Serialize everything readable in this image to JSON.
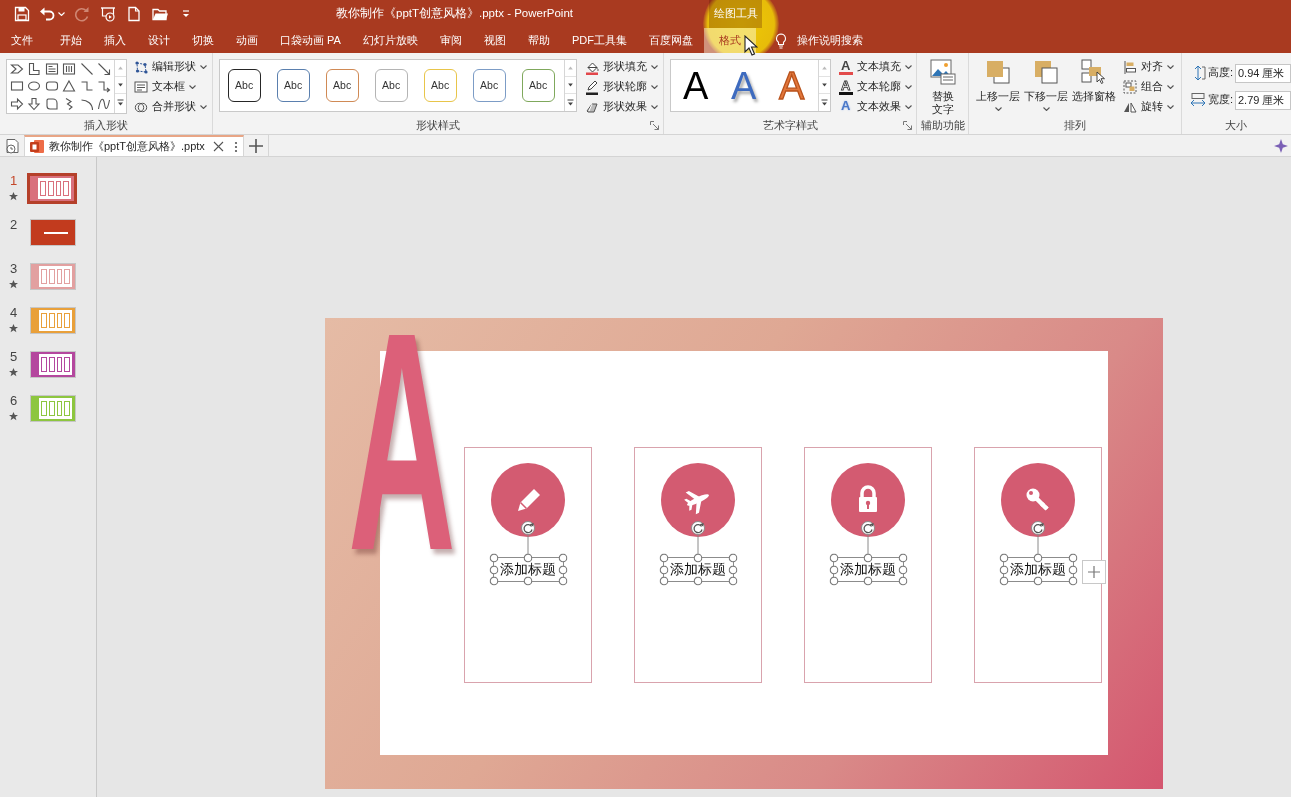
{
  "window": {
    "title": "教你制作《pptT创意风格》.pptx - PowerPoint",
    "context_label": "绘图工具"
  },
  "quick_access": [
    {
      "disabled": false
    },
    {
      "disabled": false
    },
    {
      "disabled": true
    },
    {
      "disabled": false
    },
    {
      "disabled": false
    },
    {
      "disabled": false
    },
    {
      "disabled": false
    }
  ],
  "menu": {
    "tabs": [
      {
        "label": "文件",
        "selected": false
      },
      {
        "label": "开始",
        "selected": false
      },
      {
        "label": "插入",
        "selected": false
      },
      {
        "label": "设计",
        "selected": false
      },
      {
        "label": "切换",
        "selected": false
      },
      {
        "label": "动画",
        "selected": false
      },
      {
        "label": "口袋动画 PA",
        "selected": false
      },
      {
        "label": "幻灯片放映",
        "selected": false
      },
      {
        "label": "审阅",
        "selected": false
      },
      {
        "label": "视图",
        "selected": false
      },
      {
        "label": "帮助",
        "selected": false
      },
      {
        "label": "PDF工具集",
        "selected": false
      },
      {
        "label": "百度网盘",
        "selected": false
      },
      {
        "label": "格式",
        "selected": true
      }
    ],
    "search": "操作说明搜索"
  },
  "insert_shapes": {
    "label": "插入形状",
    "commands": [
      {
        "label": "编辑形状",
        "dropdown": true
      },
      {
        "label": "文本框",
        "dropdown": true
      },
      {
        "label": "合并形状",
        "dropdown": true
      }
    ]
  },
  "shape_styles": {
    "label": "形状样式",
    "styles": [
      {
        "text": "Abc",
        "color": "#262626"
      },
      {
        "text": "Abc",
        "color": "#5a7fae"
      },
      {
        "text": "Abc",
        "color": "#d08a55"
      },
      {
        "text": "Abc",
        "color": "#b4b4b4"
      },
      {
        "text": "Abc",
        "color": "#e8c54a"
      },
      {
        "text": "Abc",
        "color": "#7c9cc6"
      },
      {
        "text": "Abc",
        "color": "#7fa85c"
      }
    ],
    "commands": [
      {
        "label": "形状填充",
        "dropdown": true
      },
      {
        "label": "形状轮廓",
        "dropdown": true
      },
      {
        "label": "形状效果",
        "dropdown": true
      }
    ]
  },
  "wordart_styles": {
    "label": "艺术字样式",
    "styles": [
      {
        "text": "A",
        "kind": "solid",
        "color": "#000000"
      },
      {
        "text": "A",
        "kind": "shadow",
        "color": "#3e6bbf"
      },
      {
        "text": "A",
        "kind": "outline",
        "color": "#e2763a"
      }
    ],
    "commands": [
      {
        "glyph": "A",
        "label": "文本填充",
        "dropdown": true
      },
      {
        "glyph": "A",
        "label": "文本轮廓",
        "dropdown": true
      },
      {
        "glyph": "A",
        "label": "文本效果",
        "dropdown": true
      }
    ]
  },
  "accessibility": {
    "label": "辅助功能",
    "commands": [
      {
        "label": "替换文字",
        "dropdown": false
      }
    ]
  },
  "arrange": {
    "label": "排列",
    "commands": [
      {
        "label": "上移一层",
        "dropdown": true
      },
      {
        "label": "下移一层",
        "dropdown": true
      },
      {
        "label": "选择窗格",
        "dropdown": false
      },
      {
        "label": "对齐",
        "dropdown": true
      },
      {
        "label": "组合",
        "dropdown": true
      },
      {
        "label": "旋转",
        "dropdown": true
      }
    ]
  },
  "size": {
    "label": "大小",
    "fields": [
      {
        "label": "高度:",
        "value": "0.94 厘米"
      },
      {
        "label": "宽度:",
        "value": "2.79 厘米"
      }
    ]
  },
  "document_tabs": [
    {
      "title": "教你制作《pptT创意风格》.pptx",
      "selected": true
    }
  ],
  "slides": [
    {
      "number": "1",
      "selected": true,
      "animated": true,
      "color": "#d9707c",
      "kind": "cards"
    },
    {
      "number": "2",
      "selected": false,
      "animated": false,
      "color": "#c23b1e",
      "kind": "cover"
    },
    {
      "number": "3",
      "selected": false,
      "animated": true,
      "color": "#e2a0a0",
      "kind": "cards"
    },
    {
      "number": "4",
      "selected": false,
      "animated": true,
      "color": "#e9a03a",
      "kind": "cards"
    },
    {
      "number": "5",
      "selected": false,
      "animated": true,
      "color": "#b4479e",
      "kind": "cards"
    },
    {
      "number": "6",
      "selected": false,
      "animated": true,
      "color": "#8dc63f",
      "kind": "cards"
    }
  ],
  "slide": {
    "letter": "A",
    "cards": [
      {
        "title": "添加标题",
        "selected": true,
        "layout_button": false
      },
      {
        "title": "添加标题",
        "selected": true,
        "layout_button": false
      },
      {
        "title": "添加标题",
        "selected": true,
        "layout_button": false
      },
      {
        "title": "添加标题",
        "selected": true,
        "layout_button": true
      }
    ]
  }
}
